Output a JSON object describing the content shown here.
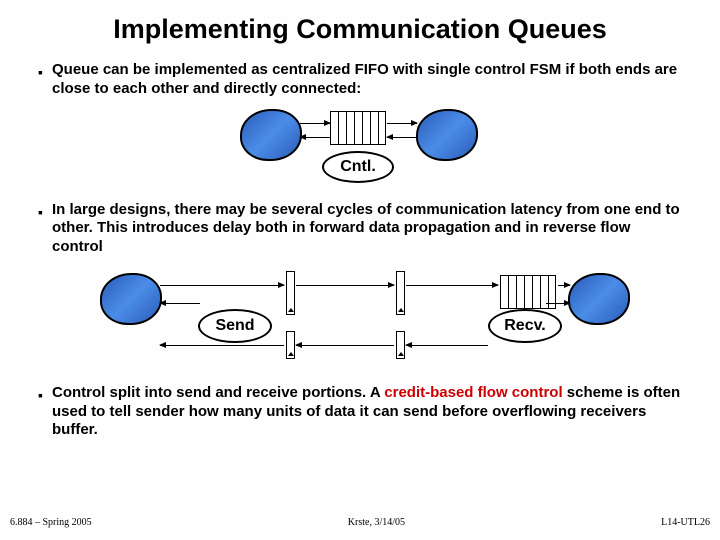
{
  "title": "Implementing Communication Queues",
  "bullets": {
    "b1": "Queue can be implemented as centralized FIFO with single control FSM if both ends are close to each other and directly connected:",
    "b2": "In large designs, there may be several cycles of communication latency from one end to other.  This introduces delay both in forward data propagation and in reverse flow control",
    "b3a": "Control split into send and receive portions.  A ",
    "b3b": "credit-based flow control",
    "b3c": " scheme is often used to tell sender how many units of data it can send before overflowing receivers buffer."
  },
  "labels": {
    "cntl": "Cntl.",
    "send": "Send",
    "recv": "Recv."
  },
  "footer": {
    "left": "6.884 – Spring 2005",
    "center": "Krste, 3/14/05",
    "right": "L14-UTL26"
  }
}
